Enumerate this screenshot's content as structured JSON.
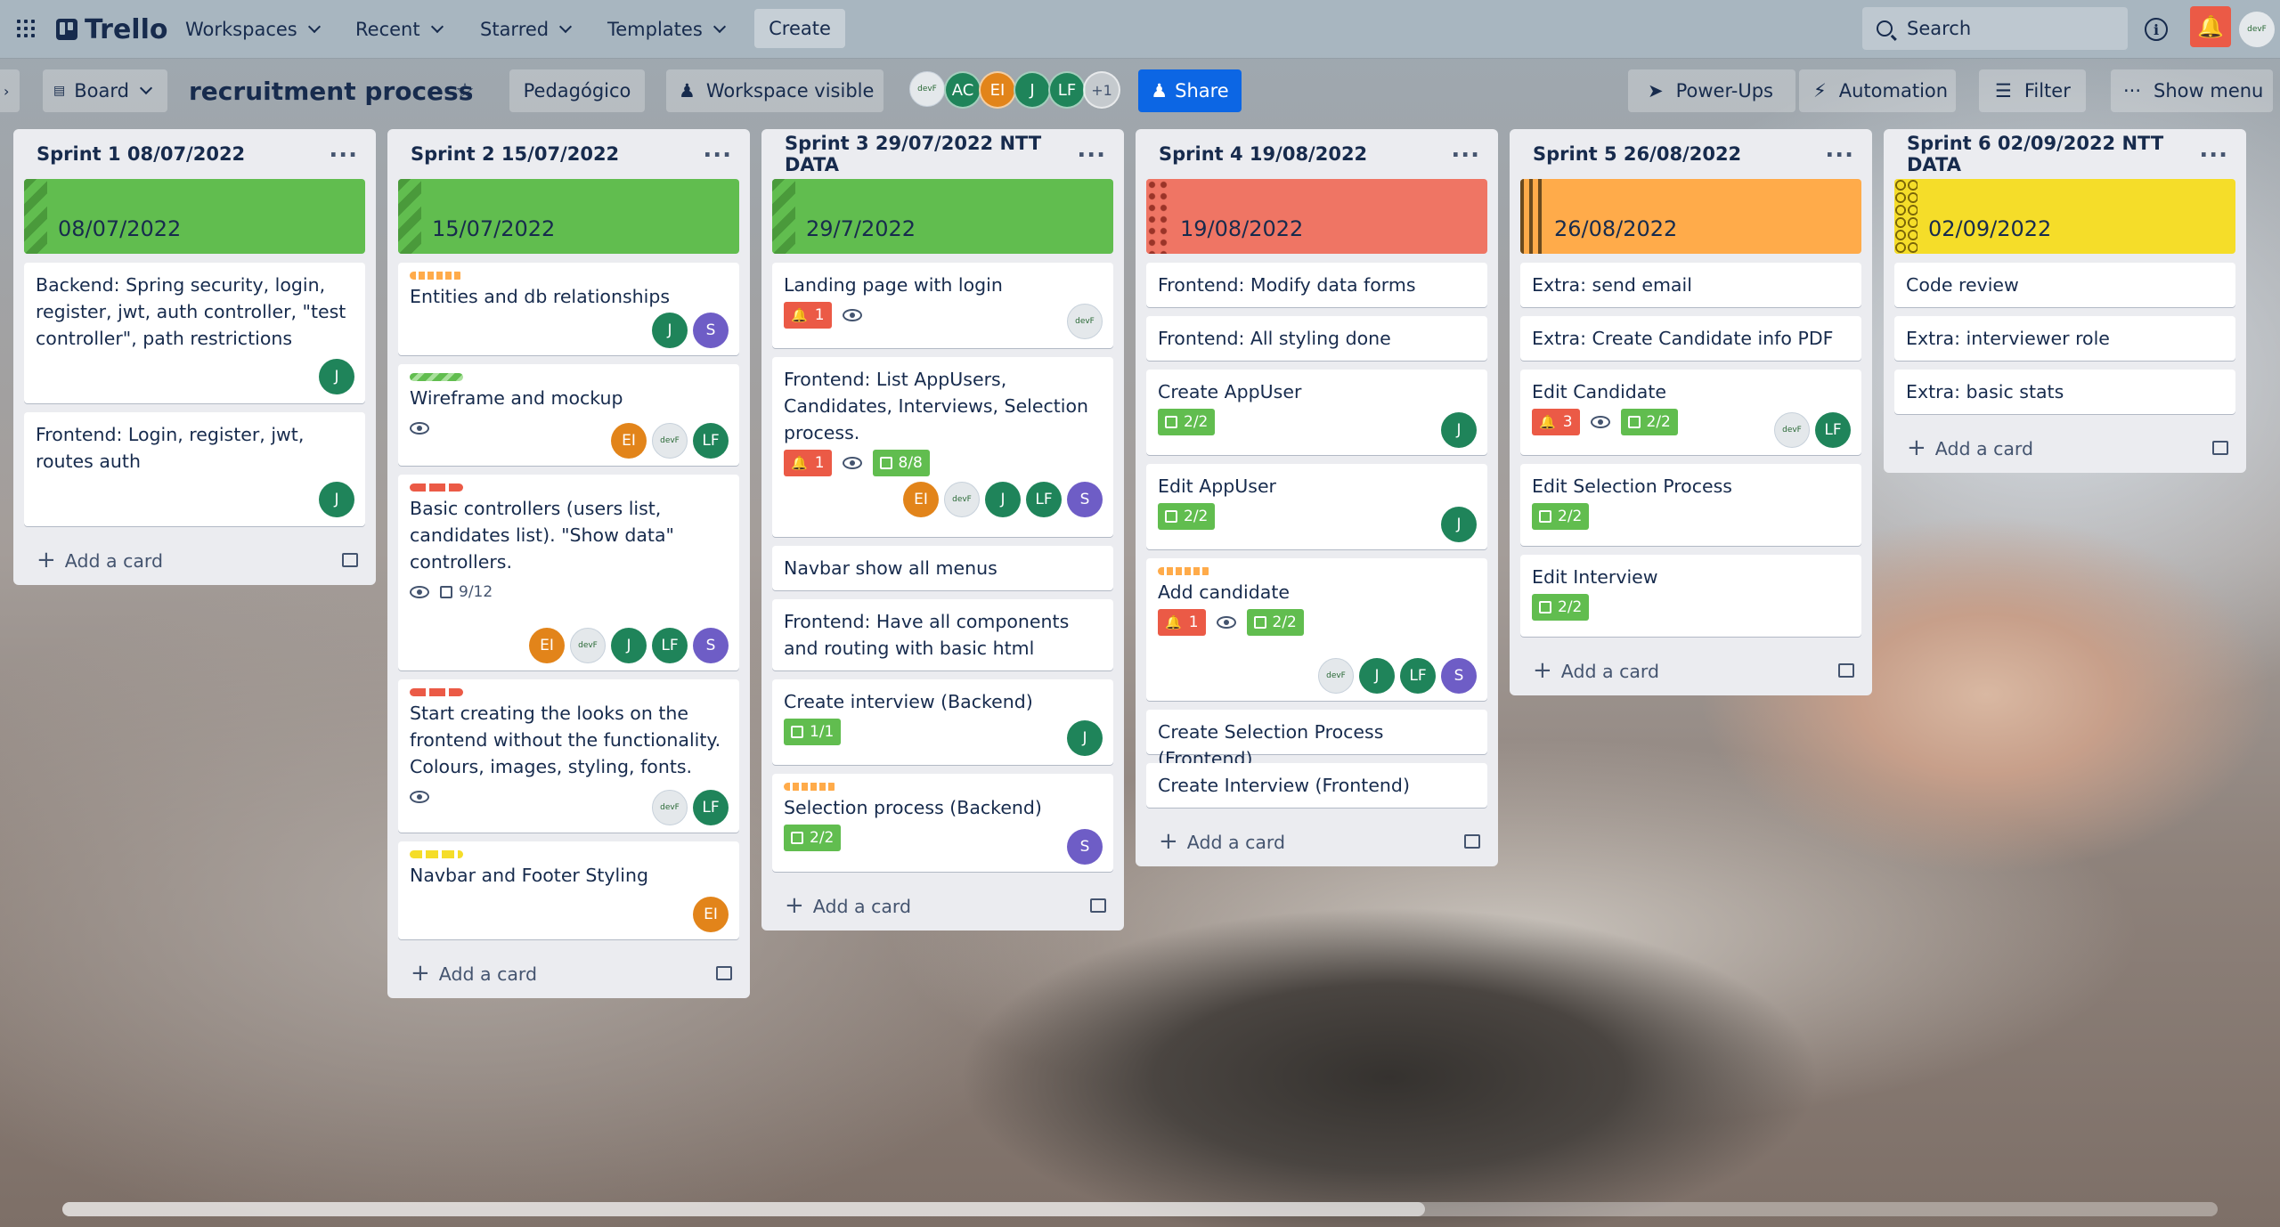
{
  "app": {
    "name": "Trello"
  },
  "nav": {
    "workspaces": "Workspaces",
    "recent": "Recent",
    "starred": "Starred",
    "templates": "Templates",
    "create": "Create",
    "search_placeholder": "Search"
  },
  "board": {
    "view": "Board",
    "title": "recruitment process",
    "workspace": "Pedagógico",
    "visibility": "Workspace visible",
    "share": "Share",
    "power_ups": "Power-Ups",
    "automation": "Automation",
    "filter": "Filter",
    "show_menu": "Show menu",
    "more_members": "+1"
  },
  "board_members": [
    {
      "initials": "AC",
      "color": "#1f845a"
    },
    {
      "initials": "EI",
      "color": "#e2841a"
    },
    {
      "initials": "J",
      "color": "#1f845a"
    },
    {
      "initials": "LF",
      "color": "#1f845a"
    }
  ],
  "colors": {
    "green": "#61bd4f",
    "red": "#eb5a46",
    "orange": "#ffab4a",
    "yellow": "#f5dd29",
    "blue": "#0c66e4"
  },
  "add_card": "Add a card",
  "lists": [
    {
      "title": "Sprint 1 08/07/2022",
      "cover": {
        "date": "08/07/2022",
        "color": "green"
      },
      "cards": [
        {
          "title": "Backend: Spring security, login, register, jwt, auth controller, \"test controller\", path restrictions",
          "members": [
            "J"
          ]
        },
        {
          "title": "Frontend: Login, register, jwt, routes auth",
          "members": [
            "J"
          ]
        }
      ]
    },
    {
      "title": "Sprint 2 15/07/2022",
      "cover": {
        "date": "15/07/2022",
        "color": "green"
      },
      "cards": [
        {
          "title": "Entities and db relationships",
          "label": "orange",
          "members": [
            "J",
            "S"
          ]
        },
        {
          "title": "Wireframe and mockup",
          "label": "green",
          "watch": true,
          "members": [
            "EI",
            "dev",
            "LF"
          ]
        },
        {
          "title": "Basic controllers (users list, candidates list). \"Show data\" controllers.",
          "label": "red",
          "watch": true,
          "checklist": "9/12",
          "members": [
            "EI",
            "dev",
            "J",
            "LF",
            "S"
          ]
        },
        {
          "title": "Start creating the looks on the frontend without the functionality. Colours, images, styling, fonts.",
          "label": "red",
          "watch": true,
          "members": [
            "dev",
            "LF"
          ]
        },
        {
          "title": "Navbar and Footer Styling",
          "label": "yellow",
          "members": [
            "EI"
          ]
        }
      ]
    },
    {
      "title": "Sprint 3 29/07/2022 NTT DATA",
      "cover": {
        "date": "29/7/2022",
        "color": "green"
      },
      "cards": [
        {
          "title": "Landing page with login",
          "notif": "1",
          "watch": true,
          "members": [
            "dev"
          ]
        },
        {
          "title": "Frontend: List AppUsers, Candidates, Interviews, Selection process.",
          "notif": "1",
          "watch": true,
          "checklist_done": "8/8",
          "members": [
            "EI",
            "dev",
            "J",
            "LF",
            "S"
          ]
        },
        {
          "title": "Navbar show all menus"
        },
        {
          "title": "Frontend: Have all components and routing with basic html"
        },
        {
          "title": "Create interview (Backend)",
          "checklist_done": "1/1",
          "members": [
            "J"
          ]
        },
        {
          "title": "Selection process (Backend)",
          "label": "orange",
          "checklist_done": "2/2",
          "members": [
            "S"
          ]
        }
      ]
    },
    {
      "title": "Sprint 4 19/08/2022",
      "cover": {
        "date": "19/08/2022",
        "color": "red"
      },
      "cards": [
        {
          "title": "Frontend: Modify data forms"
        },
        {
          "title": "Frontend: All styling done"
        },
        {
          "title": "Create AppUser",
          "checklist_done": "2/2",
          "members": [
            "J"
          ]
        },
        {
          "title": "Edit AppUser",
          "checklist_done": "2/2",
          "members": [
            "J"
          ]
        },
        {
          "title": "Add candidate",
          "label": "orange",
          "notif": "1",
          "watch": true,
          "checklist_done": "2/2",
          "members": [
            "dev",
            "J",
            "LF",
            "S"
          ]
        },
        {
          "title": "Create Selection Process (Frontend)"
        },
        {
          "title": "Create Interview (Frontend)"
        }
      ]
    },
    {
      "title": "Sprint 5 26/08/2022",
      "cover": {
        "date": "26/08/2022",
        "color": "orange"
      },
      "cards": [
        {
          "title": "Extra: send email"
        },
        {
          "title": "Extra: Create Candidate info PDF"
        },
        {
          "title": "Edit Candidate",
          "notif": "3",
          "watch": true,
          "checklist_done": "2/2",
          "members": [
            "dev",
            "LF"
          ]
        },
        {
          "title": "Edit Selection Process",
          "checklist_done": "2/2"
        },
        {
          "title": "Edit Interview",
          "checklist_done": "2/2"
        }
      ]
    },
    {
      "title": "Sprint 6 02/09/2022 NTT DATA",
      "cover": {
        "date": "02/09/2022",
        "color": "yellow"
      },
      "cards": [
        {
          "title": "Code review"
        },
        {
          "title": "Extra: interviewer role"
        },
        {
          "title": "Extra: basic stats"
        }
      ]
    }
  ]
}
